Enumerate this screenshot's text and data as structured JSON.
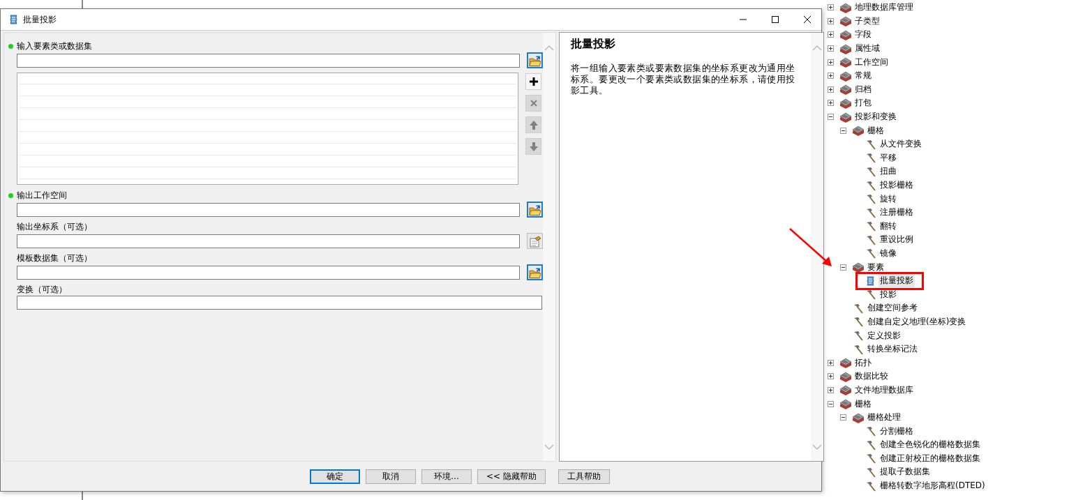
{
  "window": {
    "title": "批量投影"
  },
  "form": {
    "parameters": [
      {
        "label": "输入要素类或数据集",
        "required": true,
        "kind": "multi",
        "button": {
          "kind": "folder"
        },
        "list_buttons": [
          {
            "kind": "add",
            "disabled": false
          },
          {
            "kind": "remove",
            "disabled": true
          },
          {
            "kind": "up",
            "disabled": true
          },
          {
            "kind": "down",
            "disabled": true
          }
        ]
      },
      {
        "label": "输出工作空间",
        "required": true,
        "kind": "field",
        "button": {
          "kind": "folder"
        }
      },
      {
        "label": "输出坐标系（可选）",
        "required": false,
        "kind": "field",
        "button": {
          "kind": "properties"
        }
      },
      {
        "label": "模板数据集（可选）",
        "required": false,
        "kind": "field",
        "button": {
          "kind": "folder"
        }
      },
      {
        "label": "变换（可选）",
        "required": false,
        "kind": "field"
      }
    ]
  },
  "help": {
    "title": "批量投影",
    "text": "将一组输入要素类或要素数据集的坐标系更改为通用坐标系。要更改一个要素类或数据集的坐标系，请使用投影工具。"
  },
  "buttons": [
    {
      "label": "确定",
      "default": true
    },
    {
      "label": "取消",
      "default": false
    },
    {
      "label": "环境...",
      "default": false
    },
    {
      "label": "<< 隐藏帮助",
      "default": false
    },
    {
      "label": "工具帮助",
      "default": false
    }
  ],
  "tree": [
    {
      "label": "地理数据库管理",
      "kind": "toolbox",
      "expanded": false,
      "selected": false,
      "marked": false
    },
    {
      "label": "子类型",
      "kind": "toolbox",
      "expanded": false,
      "selected": false,
      "marked": false
    },
    {
      "label": "字段",
      "kind": "toolbox",
      "expanded": false,
      "selected": false,
      "marked": false
    },
    {
      "label": "属性域",
      "kind": "toolbox",
      "expanded": false,
      "selected": false,
      "marked": false
    },
    {
      "label": "工作空间",
      "kind": "toolbox",
      "expanded": false,
      "selected": false,
      "marked": false
    },
    {
      "label": "常规",
      "kind": "toolbox",
      "expanded": false,
      "selected": false,
      "marked": false
    },
    {
      "label": "归档",
      "kind": "toolbox",
      "expanded": false,
      "selected": false,
      "marked": false
    },
    {
      "label": "打包",
      "kind": "toolbox",
      "expanded": false,
      "selected": false,
      "marked": false
    },
    {
      "label": "投影和变换",
      "kind": "toolbox",
      "expanded": true,
      "selected": false,
      "marked": false,
      "children": [
        {
          "label": "栅格",
          "kind": "toolbox",
          "expanded": true,
          "selected": false,
          "marked": false,
          "children": [
            {
              "label": "从文件变换",
              "kind": "tool",
              "selected": false,
              "marked": false
            },
            {
              "label": "平移",
              "kind": "tool",
              "selected": false,
              "marked": false
            },
            {
              "label": "扭曲",
              "kind": "tool",
              "selected": false,
              "marked": false
            },
            {
              "label": "投影栅格",
              "kind": "tool",
              "selected": false,
              "marked": false
            },
            {
              "label": "旋转",
              "kind": "tool",
              "selected": false,
              "marked": false
            },
            {
              "label": "注册栅格",
              "kind": "tool",
              "selected": false,
              "marked": false
            },
            {
              "label": "翻转",
              "kind": "tool",
              "selected": false,
              "marked": false
            },
            {
              "label": "重设比例",
              "kind": "tool",
              "selected": false,
              "marked": false
            },
            {
              "label": "镜像",
              "kind": "tool",
              "selected": false,
              "marked": false
            }
          ]
        },
        {
          "label": "要素",
          "kind": "toolbox",
          "expanded": true,
          "selected": false,
          "marked": false,
          "children": [
            {
              "label": "批量投影",
              "kind": "script",
              "selected": true,
              "marked": true
            },
            {
              "label": "投影",
              "kind": "tool",
              "selected": false,
              "marked": false
            }
          ]
        },
        {
          "label": "创建空间参考",
          "kind": "tool",
          "selected": false,
          "marked": false
        },
        {
          "label": "创建自定义地理(坐标)变换",
          "kind": "tool",
          "selected": false,
          "marked": false
        },
        {
          "label": "定义投影",
          "kind": "tool",
          "selected": false,
          "marked": false
        },
        {
          "label": "转换坐标记法",
          "kind": "tool",
          "selected": false,
          "marked": false
        }
      ]
    },
    {
      "label": "拓扑",
      "kind": "toolbox",
      "expanded": false,
      "selected": false,
      "marked": false
    },
    {
      "label": "数据比较",
      "kind": "toolbox",
      "expanded": false,
      "selected": false,
      "marked": false
    },
    {
      "label": "文件地理数据库",
      "kind": "toolbox",
      "expanded": false,
      "selected": false,
      "marked": false
    },
    {
      "label": "栅格",
      "kind": "toolbox",
      "expanded": true,
      "selected": false,
      "marked": false,
      "children": [
        {
          "label": "栅格处理",
          "kind": "toolbox",
          "expanded": true,
          "selected": false,
          "marked": false,
          "children": [
            {
              "label": "分割栅格",
              "kind": "tool",
              "selected": false,
              "marked": false
            },
            {
              "label": "创建全色锐化的栅格数据集",
              "kind": "tool",
              "selected": false,
              "marked": false
            },
            {
              "label": "创建正射校正的栅格数据集",
              "kind": "tool",
              "selected": false,
              "marked": false
            },
            {
              "label": "提取子数据集",
              "kind": "tool",
              "selected": false,
              "marked": false
            },
            {
              "label": "栅格转数字地形高程(DTED)",
              "kind": "tool",
              "selected": false,
              "marked": false
            }
          ]
        }
      ]
    }
  ]
}
